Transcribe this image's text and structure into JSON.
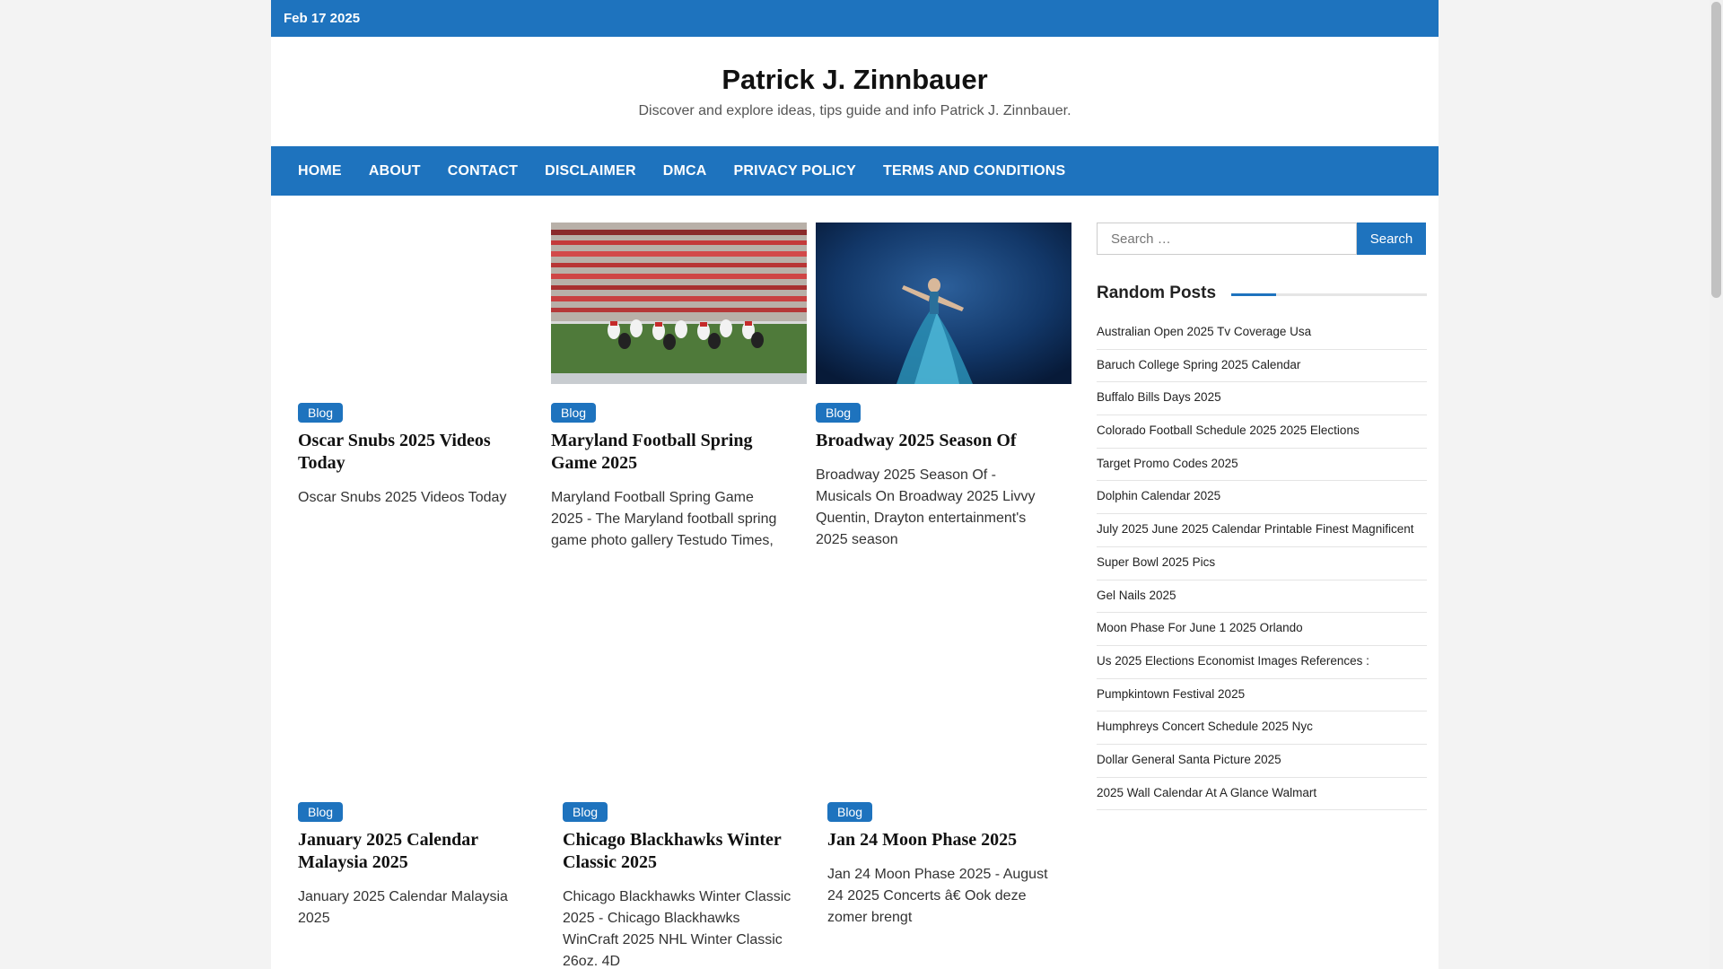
{
  "topbar": {
    "date": "Feb 17 2025"
  },
  "site": {
    "title": "Patrick J. Zinnbauer",
    "description": "Discover and explore ideas, tips guide and info Patrick J. Zinnbauer."
  },
  "nav": {
    "items": [
      "HOME",
      "ABOUT",
      "CONTACT",
      "DISCLAIMER",
      "DMCA",
      "PRIVACY POLICY",
      "TERMS AND CONDITIONS"
    ]
  },
  "posts": [
    {
      "category": "Blog",
      "title": "Oscar Snubs 2025 Videos Today",
      "excerpt": "Oscar Snubs 2025 Videos Today",
      "thumbnail": "none"
    },
    {
      "category": "Blog",
      "title": "Maryland Football Spring Game 2025",
      "excerpt": "Maryland Football Spring Game 2025 - The Maryland football spring game photo gallery Testudo Times,",
      "thumbnail": "football-stadium-photo"
    },
    {
      "category": "Blog",
      "title": "Broadway 2025 Season Of",
      "excerpt": "Broadway 2025 Season Of - Musicals On Broadway 2025 Livvy Quentin, Drayton entertainment's 2025 season",
      "thumbnail": "dancer-on-stage-photo"
    },
    {
      "category": "Blog",
      "title": "January 2025 Calendar Malaysia 2025",
      "excerpt": "January 2025 Calendar Malaysia 2025",
      "thumbnail": "none"
    },
    {
      "category": "Blog",
      "title": "Chicago Blackhawks Winter Classic 2025",
      "excerpt": "Chicago Blackhawks Winter Classic 2025 - Chicago Blackhawks WinCraft 2025 NHL Winter Classic 26oz. 4D",
      "thumbnail": "none"
    },
    {
      "category": "Blog",
      "title": "Jan 24 Moon Phase 2025",
      "excerpt": "Jan 24 Moon Phase 2025 - August 24 2025 Concerts â€ Ook deze zomer brengt",
      "thumbnail": "none"
    }
  ],
  "sidebar": {
    "search": {
      "placeholder": "Search …",
      "button": "Search"
    },
    "random_posts_title": "Random Posts",
    "random_posts": [
      "Australian Open 2025 Tv Coverage Usa",
      "Baruch College Spring 2025 Calendar",
      "Buffalo Bills Days 2025",
      "Colorado Football Schedule 2025 2025 Elections",
      "Target Promo Codes 2025",
      "Dolphin Calendar 2025",
      "July 2025 June 2025 Calendar Printable Finest Magnificent",
      "Super Bowl 2025 Pics",
      "Gel Nails 2025",
      "Moon Phase For June 1 2025 Orlando",
      "Us 2025 Elections Economist Images References :",
      "Pumpkintown Festival 2025",
      "Humphreys Concert Schedule 2025 Nyc",
      "Dollar General Santa Picture 2025",
      "2025 Wall Calendar At A Glance Walmart"
    ]
  },
  "colors": {
    "accent": "#1e73be",
    "background": "#f3f3f3",
    "text": "#111111"
  }
}
